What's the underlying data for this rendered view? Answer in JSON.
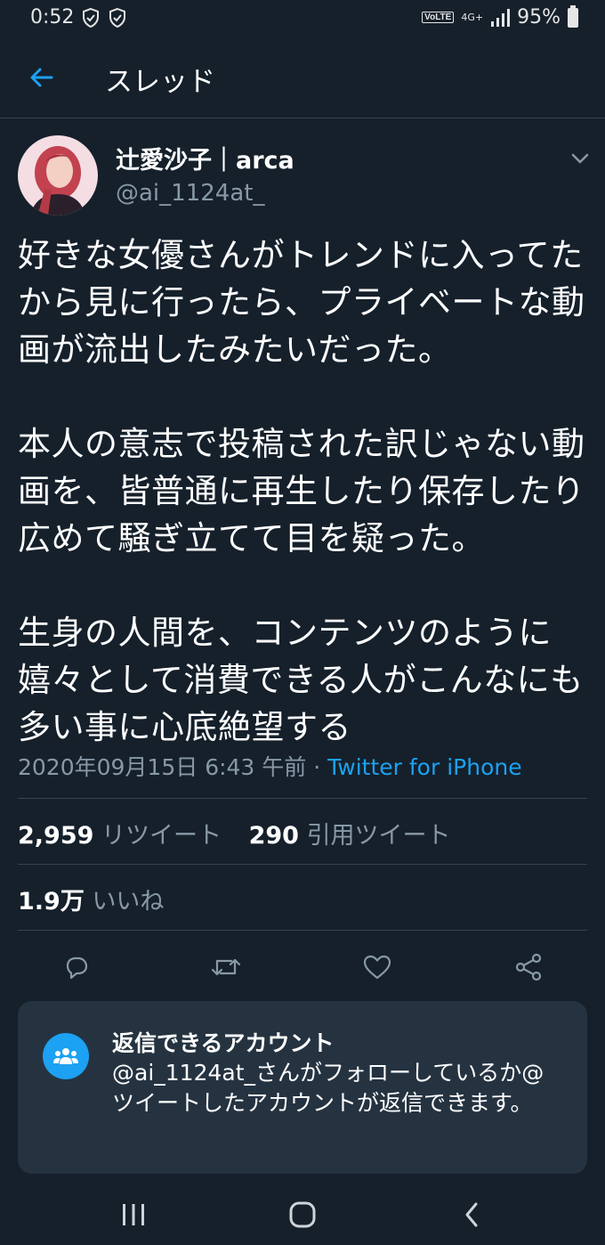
{
  "status_bar": {
    "time": "0:52",
    "volte": "VoLTE",
    "network": "4G+",
    "battery": "95%"
  },
  "header": {
    "title": "スレッド"
  },
  "tweet": {
    "author_name": "辻愛沙子｜arca",
    "author_handle": "@ai_1124at_",
    "text": "好きな女優さんがトレンドに入ってたから見に行ったら、プライベートな動画が流出したみたいだった。\n\n本人の意志で投稿された訳じゃない動画を、皆普通に再生したり保存したり広めて騒ぎ立てて目を疑った。\n\n生身の人間を、コンテンツのように嬉々として消費できる人がこんなにも多い事に心底絶望する",
    "timestamp": "2020年09月15日 6:43 午前",
    "separator": "·",
    "source": "Twitter for iPhone"
  },
  "stats": {
    "retweets_count": "2,959",
    "retweets_label": "リツイート",
    "quotes_count": "290",
    "quotes_label": "引用ツイート",
    "likes_count": "1.9万",
    "likes_label": "いいね"
  },
  "reply_restriction": {
    "title": "返信できるアカウント",
    "description": "@ai_1124at_さんがフォローしているか@ツイートしたアカウントが返信できます。"
  },
  "icons": {
    "back": "arrow-left-icon",
    "menu": "chevron-down-icon",
    "reply": "reply-icon",
    "retweet": "retweet-icon",
    "like": "heart-icon",
    "share": "share-icon",
    "people": "people-icon"
  },
  "colors": {
    "background": "#15202b",
    "accent": "#1da1f2",
    "secondary_text": "#8899a6",
    "divider": "#38444d",
    "card": "#253341"
  }
}
